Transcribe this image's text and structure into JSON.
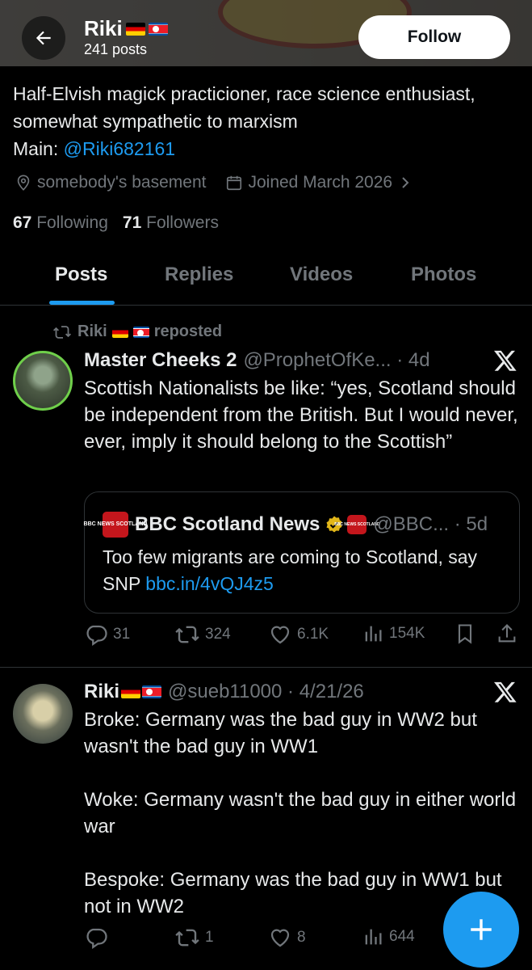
{
  "header": {
    "name": "Riki",
    "posts_count": "241 posts",
    "follow_label": "Follow"
  },
  "profile": {
    "bio_text": "Half-Elvish magick practicioner, race science enthusiast, somewhat sympathetic to marxism",
    "bio_main_prefix": "Main: ",
    "bio_main_link": "@Riki682161",
    "location": "somebody's basement",
    "joined": "Joined March 2026",
    "following_count": "67",
    "following_label": "Following",
    "followers_count": "71",
    "followers_label": "Followers"
  },
  "tabs": [
    {
      "label": "Posts",
      "active": true
    },
    {
      "label": "Replies",
      "active": false
    },
    {
      "label": "Videos",
      "active": false
    },
    {
      "label": "Photos",
      "active": false
    }
  ],
  "posts": [
    {
      "repost_by": "Riki",
      "repost_label": "reposted",
      "author_name": "Master Cheeks 2",
      "handle_time": "@ProphetOfKe... · 4d",
      "text": "Scottish Nationalists be like: “yes, Scotland should be independent from the British. But I would never, ever, imply it should belong to the Scottish”",
      "quote": {
        "logo_text": "BBC NEWS SCOTLAND",
        "author_name": "BBC Scotland News",
        "handle_time": "@BBC... · 5d",
        "text": "Too few migrants are coming to Scotland, say SNP ",
        "link": "bbc.in/4vQJ4z5"
      },
      "stats": {
        "replies": "31",
        "reposts": "324",
        "likes": "6.1K",
        "views": "154K"
      }
    },
    {
      "author_name": "Riki",
      "handle_time": "@sueb11000 · 4/21/26",
      "text": "Broke: Germany was the bad guy in WW2 but wasn't the bad guy in WW1\n\nWoke: Germany wasn't the bad guy in either world war\n\nBespoke: Germany was the bad guy in WW1 but not in WW2",
      "stats": {
        "replies": "",
        "reposts": "1",
        "likes": "8",
        "views": "644"
      }
    }
  ],
  "colors": {
    "accent": "#1d9bf0",
    "muted": "#71767b",
    "text": "#e7e9ea",
    "background": "#000000",
    "bbc_red": "#c4161c",
    "verified_gold": "#e2b719"
  }
}
